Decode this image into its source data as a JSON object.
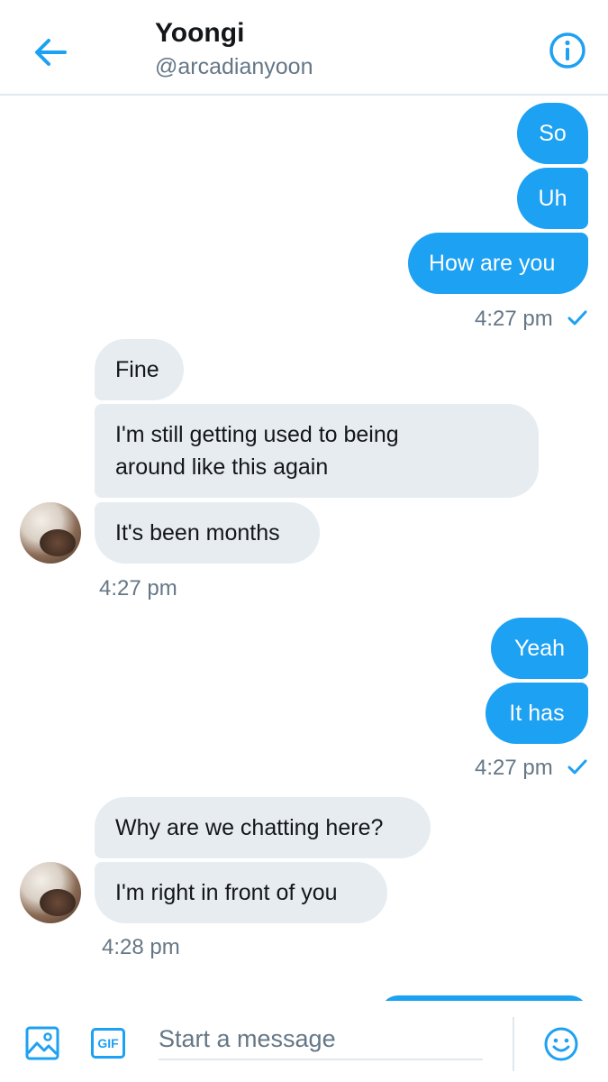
{
  "header": {
    "name": "Yoongi",
    "handle": "@arcadianyoon",
    "back_icon": "arrow-left-icon",
    "info_icon": "info-icon"
  },
  "colors": {
    "accent": "#1da1f2",
    "received_bubble": "#e6ecf0",
    "muted_text": "#657786"
  },
  "messages": {
    "g1": {
      "m1": "So",
      "m2": "Uh",
      "m3": "How are you",
      "time": "4:27 pm"
    },
    "g2": {
      "m1": "Fine",
      "m2a": "I'm still getting used to being",
      "m2b": "around like this again",
      "m3": "It's been months",
      "time": "4:27 pm"
    },
    "g3": {
      "m1": "Yeah",
      "m2": "It has",
      "time": "4:27 pm"
    },
    "g4": {
      "m1": "Why are we chatting here?",
      "m2": "I'm right in front of you",
      "time": "4:28 pm"
    }
  },
  "composer": {
    "placeholder": "Start a message",
    "gif_label": "GIF",
    "media_icon": "image-icon",
    "emoji_icon": "emoji-icon"
  }
}
